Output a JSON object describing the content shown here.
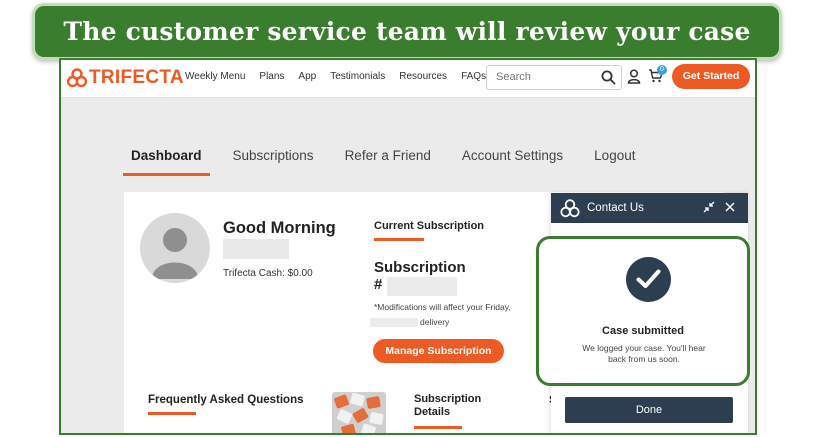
{
  "banner": {
    "text": "The customer service team will review your case"
  },
  "header": {
    "brand": "TRIFECTA",
    "nav": [
      "Weekly Menu",
      "Plans",
      "App",
      "Testimonials",
      "Resources",
      "FAQs"
    ],
    "search_placeholder": "Search",
    "cart_count": "0",
    "cta_label": "Get Started"
  },
  "tabs": [
    {
      "label": "Dashboard",
      "active": true
    },
    {
      "label": "Subscriptions",
      "active": false
    },
    {
      "label": "Refer a Friend",
      "active": false
    },
    {
      "label": "Account Settings",
      "active": false
    },
    {
      "label": "Logout",
      "active": false
    }
  ],
  "profile": {
    "greeting": "Good Morning",
    "cash": "Trifecta Cash: $0.00"
  },
  "subscription": {
    "section_title": "Current Subscription",
    "title": "Subscription",
    "number_prefix": "#",
    "note": "*Modifications will affect your Friday,",
    "delivery": "delivery",
    "manage_label": "Manage Subscription"
  },
  "lower": {
    "faq_title": "Frequently Asked Questions",
    "details_title": "Subscription Details",
    "peek": "S"
  },
  "contact": {
    "title": "Contact Us",
    "case_title": "Case submitted",
    "case_message": "We logged your case. You'll hear back from us soon.",
    "done_label": "Done"
  },
  "colors": {
    "brand_orange": "#ee5a24",
    "banner_green": "#3a7d2e",
    "widget_navy": "#2c3e50"
  }
}
